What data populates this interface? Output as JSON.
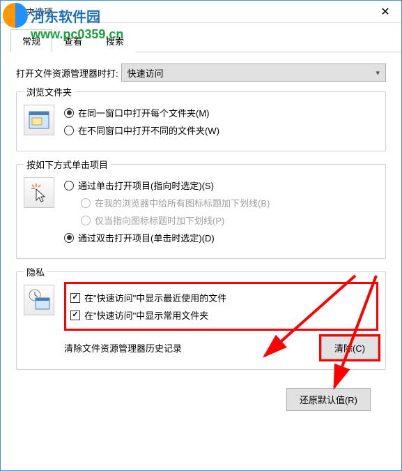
{
  "window": {
    "title": "文件夹选项"
  },
  "watermark": {
    "brand": "河东软件园",
    "url": "www.pc0359.cn"
  },
  "tabs": {
    "general": "常规",
    "view": "查看",
    "search": "搜索"
  },
  "open_with": {
    "label": "打开文件资源管理器时打:",
    "value": "快速访问"
  },
  "browse_group": {
    "legend": "浏览文件夹",
    "opt1": "在同一窗口中打开每个文件夹(M)",
    "opt2": "在不同窗口中打开不同的文件夹(W)"
  },
  "click_group": {
    "legend": "按如下方式单击项目",
    "opt1": "通过单击打开项目(指向时选定)(S)",
    "sub1": "在我的浏览器中给所有图标标题加下划线(B)",
    "sub2": "仅当指向图标标题时加下划线(P)",
    "opt2": "通过双击打开项目(单击时选定)(D)"
  },
  "privacy_group": {
    "legend": "隐私",
    "chk1": "在\"快速访问\"中显示最近使用的文件",
    "chk2": "在\"快速访问\"中显示常用文件夹",
    "clear_label": "清除文件资源管理器历史记录",
    "clear_btn": "清除(C)"
  },
  "footer": {
    "restore": "还原默认值(R)"
  }
}
